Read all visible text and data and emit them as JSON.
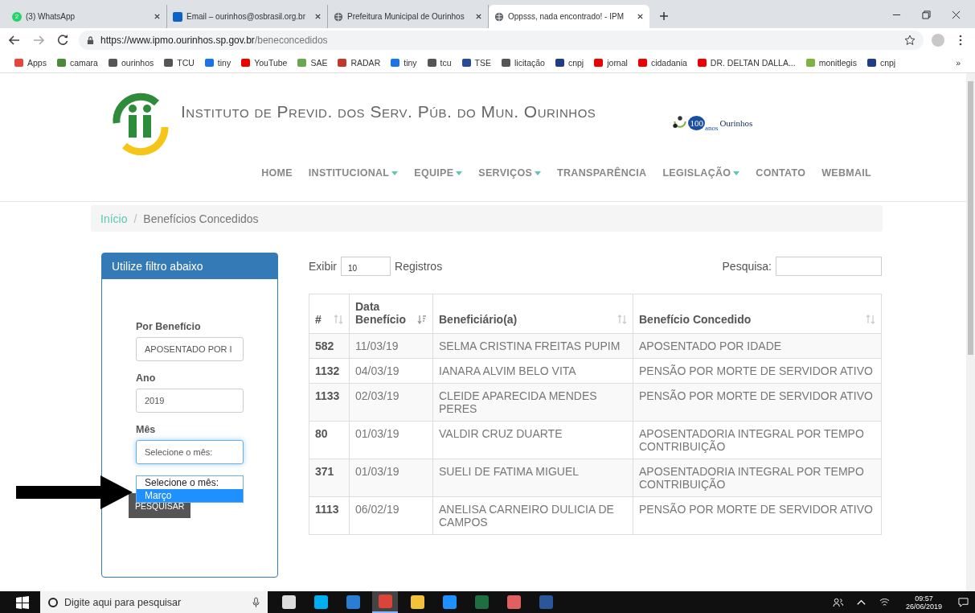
{
  "browser": {
    "tabs": [
      {
        "title": "(3) WhatsApp",
        "badge": "2",
        "kind": "whatsapp",
        "selected": false
      },
      {
        "title": "Email – ourinhos@osbrasil.org.br",
        "kind": "outlook",
        "selected": false
      },
      {
        "title": "Prefeitura Municipal de Ourinhos",
        "kind": "globe",
        "selected": false
      },
      {
        "title": "Oppsss, nada encontrado! - IPM",
        "kind": "globe",
        "selected": true
      }
    ],
    "url_host": "https://www.ipmo.ourinhos.sp.gov.br",
    "url_path": "/beneconcedidos",
    "bookmarks": [
      {
        "label": "Apps",
        "kind": "apps"
      },
      {
        "label": "camara",
        "kind": "crest"
      },
      {
        "label": "ourinhos",
        "kind": "globe"
      },
      {
        "label": "TCU",
        "kind": "globe"
      },
      {
        "label": "tiny",
        "kind": "dots"
      },
      {
        "label": "YouTube",
        "kind": "youtube"
      },
      {
        "label": "SAE",
        "kind": "sae"
      },
      {
        "label": "RADAR",
        "kind": "radar"
      },
      {
        "label": "tiny",
        "kind": "dots"
      },
      {
        "label": "tcu",
        "kind": "globe"
      },
      {
        "label": "TSE",
        "kind": "tse"
      },
      {
        "label": "licitação",
        "kind": "globe"
      },
      {
        "label": "cnpj",
        "kind": "cnpj"
      },
      {
        "label": "jornal",
        "kind": "youtube"
      },
      {
        "label": "cidadania",
        "kind": "youtube"
      },
      {
        "label": "DR. DELTAN DALLA...",
        "kind": "youtube"
      },
      {
        "label": "monitlegis",
        "kind": "leaf"
      },
      {
        "label": "cnpj",
        "kind": "cnpj"
      }
    ],
    "bookmarks_more": "»"
  },
  "site": {
    "title": "Instituto de Previd. dos Serv. Púb. do Mun. Ourinhos",
    "anniversary_logo": {
      "number": "100",
      "word": "anos",
      "city": "Ourinhos"
    },
    "nav": [
      {
        "label": "HOME",
        "dropdown": false
      },
      {
        "label": "INSTITUCIONAL",
        "dropdown": true
      },
      {
        "label": "EQUIPE",
        "dropdown": true
      },
      {
        "label": "SERVIÇOS",
        "dropdown": true
      },
      {
        "label": "TRANSPARÊNCIA",
        "dropdown": false
      },
      {
        "label": "LEGISLAÇÃO",
        "dropdown": true
      },
      {
        "label": "CONTATO",
        "dropdown": false
      },
      {
        "label": "WEBMAIL",
        "dropdown": false
      }
    ],
    "breadcrumb": [
      {
        "label": "Início",
        "link": true
      },
      {
        "label": "Benefícios Concedidos",
        "link": false
      }
    ],
    "breadcrumb_separator": "/"
  },
  "filter": {
    "title": "Utilize filtro abaixo",
    "fields": [
      {
        "label": "Por Benefício",
        "value": "APOSENTADO POR I"
      },
      {
        "label": "Ano",
        "value": "2019"
      },
      {
        "label": "Mês",
        "value": "Selecione o mês:"
      }
    ],
    "dropdown_options": [
      {
        "label": "Selecione o mês:",
        "selected": false
      },
      {
        "label": "Março",
        "selected": true
      }
    ],
    "button": "PESQUISAR"
  },
  "table": {
    "show_label": "Exibir",
    "page_size": "10",
    "records_label": "Registros",
    "search_label": "Pesquisa:",
    "columns": [
      {
        "label": "#",
        "sorted": false
      },
      {
        "label": "Data Benefício",
        "sorted": true
      },
      {
        "label": "Beneficiário(a)",
        "sorted": false
      },
      {
        "label": "Benefício Concedido",
        "sorted": false
      }
    ],
    "rows": [
      [
        "582",
        "11/03/19",
        "SELMA CRISTINA FREITAS PUPIM",
        "APOSENTADO POR IDADE"
      ],
      [
        "1132",
        "04/03/19",
        "IANARA ALVIM BELO VITA",
        "PENSÃO POR MORTE DE SERVIDOR ATIVO"
      ],
      [
        "1133",
        "02/03/19",
        "CLEIDE APARECIDA MENDES PERES",
        "PENSÃO POR MORTE DE SERVIDOR ATIVO"
      ],
      [
        "80",
        "01/03/19",
        "VALDIR CRUZ DUARTE",
        "APOSENTADORIA INTEGRAL POR TEMPO CONTRIBUIÇÃO"
      ],
      [
        "371",
        "01/03/19",
        "SUELI DE FATIMA MIGUEL",
        "APOSENTADORIA INTEGRAL POR TEMPO CONTRIBUIÇÃO"
      ],
      [
        "1113",
        "06/02/19",
        "ANELISA CARNEIRO DULICIA DE CAMPOS",
        "PENSÃO POR MORTE DE SERVIDOR ATIVO"
      ]
    ]
  },
  "taskbar": {
    "search_placeholder": "Digite aqui para pesquisar",
    "time": "09:57",
    "date": "26/06/2019",
    "apps": [
      {
        "kind": "taskview",
        "selected": false
      },
      {
        "kind": "skype",
        "selected": false
      },
      {
        "kind": "mail",
        "selected": false
      },
      {
        "kind": "chrome",
        "selected": true
      },
      {
        "kind": "folder",
        "selected": false
      },
      {
        "kind": "edge",
        "selected": false
      },
      {
        "kind": "excel",
        "selected": false
      },
      {
        "kind": "paint",
        "selected": false
      },
      {
        "kind": "word",
        "selected": false
      }
    ]
  }
}
